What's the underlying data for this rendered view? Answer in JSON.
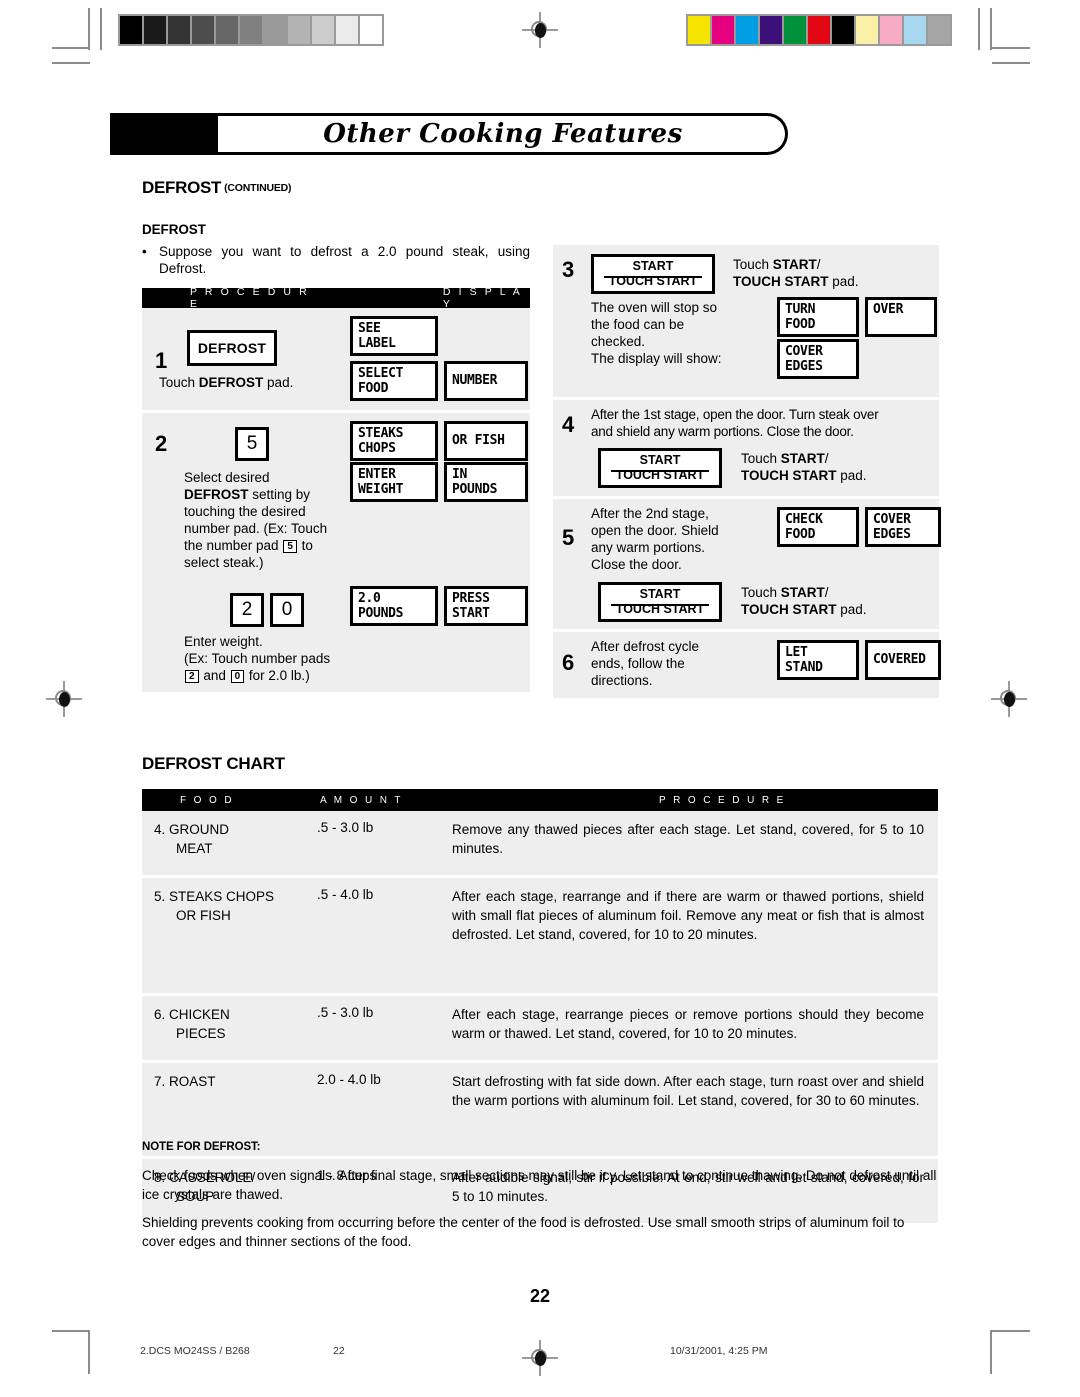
{
  "print_marks": {
    "grayscale_swatches": [
      "#000000",
      "#1a1a1a",
      "#333333",
      "#4d4d4d",
      "#666666",
      "#808080",
      "#999999",
      "#b3b3b3",
      "#cccccc",
      "#ebebeb",
      "#ffffff"
    ],
    "color_swatches": [
      "#f5e400",
      "#e4007f",
      "#009fe3",
      "#3b1079",
      "#00913a",
      "#e30613",
      "#000000",
      "#fbf0a8",
      "#f7abc4",
      "#a8d8f0",
      "#a6a6a6"
    ],
    "registration_icon": "registration-target-icon"
  },
  "header": {
    "chapter_title": "Other Cooking Features",
    "kicker": "DEFROST",
    "kicker_continued": "(CONTINUED)"
  },
  "intro": {
    "heading": "DEFROST",
    "bullet": "•",
    "text": "Suppose you want to defrost a 2.0 pound steak, using Defrost."
  },
  "procedure_table": {
    "col_procedure": "P R O C E D U R E",
    "col_display": "D I S P L A Y",
    "steps": [
      {
        "num": "1",
        "pad_label": "DEFROST",
        "caption_pre": "Touch ",
        "caption_bold": "DEFROST",
        "caption_post": " pad.",
        "displays": [
          {
            "lines": [
              "SEE",
              "LABEL"
            ]
          },
          {
            "lines": [
              "SELECT",
              "FOOD"
            ]
          },
          {
            "lines": [
              "NUMBER"
            ]
          }
        ]
      },
      {
        "num": "2",
        "numpad": "5",
        "caption_a_l1": "Select desired",
        "caption_a_bold": "DEFROST",
        "caption_a_l2": " setting by",
        "caption_a_l3": "touching the desired",
        "caption_a_l4a": "number pad. (Ex: Touch",
        "caption_a_l5a": "the number pad ",
        "caption_a_key": "5",
        "caption_a_l5b": " to",
        "caption_a_l6": "select steak.)",
        "numpad2": "2",
        "numpad3": "0",
        "caption_b_l1": "Enter weight.",
        "caption_b_l2": "(Ex: Touch number pads",
        "caption_b_key1": "2",
        "caption_b_mid": " and ",
        "caption_b_key2": "0",
        "caption_b_end": " for 2.0 lb.)",
        "displays": [
          {
            "lines": [
              "STEAKS",
              "CHOPS"
            ]
          },
          {
            "lines": [
              "OR FISH"
            ]
          },
          {
            "lines": [
              "ENTER",
              "WEIGHT"
            ]
          },
          {
            "lines": [
              "IN",
              "POUNDS"
            ]
          },
          {
            "lines": [
              "2.0",
              "POUNDS"
            ]
          },
          {
            "lines": [
              "PRESS",
              "START"
            ]
          }
        ]
      },
      {
        "num": "3",
        "start_pad_l1": "START",
        "start_pad_l2": "TOUCH START",
        "caption_pre": "Touch ",
        "caption_bold1": "START",
        "caption_slash": "/",
        "caption_bold2": "TOUCH START",
        "caption_post": " pad.",
        "body_l1": "The oven will stop so",
        "body_l2": "the food can be",
        "body_l3": "checked.",
        "body_l4": "The display will show:",
        "displays": [
          {
            "lines": [
              "TURN",
              "FOOD"
            ]
          },
          {
            "lines": [
              "OVER"
            ]
          },
          {
            "lines": [
              "COVER",
              "EDGES"
            ]
          }
        ]
      },
      {
        "num": "4",
        "body_l1": "After the 1st stage, open the door. Turn steak over",
        "body_l2": "and shield any warm portions. Close the door.",
        "start_pad_l1": "START",
        "start_pad_l2": "TOUCH START",
        "caption_pre": "Touch ",
        "caption_bold1": "START",
        "caption_slash": "/",
        "caption_bold2": "TOUCH START",
        "caption_post": " pad."
      },
      {
        "num": "5",
        "body_l1": "After the 2nd stage,",
        "body_l2": "open the door. Shield",
        "body_l3": "any warm portions.",
        "body_l4": "Close the door.",
        "start_pad_l1": "START",
        "start_pad_l2": "TOUCH START",
        "caption_pre": "Touch ",
        "caption_bold1": "START",
        "caption_slash": "/",
        "caption_bold2": "TOUCH START",
        "caption_post": " pad.",
        "displays": [
          {
            "lines": [
              "CHECK",
              "FOOD"
            ]
          },
          {
            "lines": [
              "COVER",
              "EDGES"
            ]
          }
        ]
      },
      {
        "num": "6",
        "body_l1": "After defrost cycle",
        "body_l2": "ends, follow the",
        "body_l3": "directions.",
        "displays": [
          {
            "lines": [
              "LET",
              "STAND"
            ]
          },
          {
            "lines": [
              "COVERED"
            ]
          }
        ]
      }
    ]
  },
  "defrost_chart": {
    "heading": "DEFROST CHART",
    "columns": [
      "F O O D",
      "A M O U N T",
      "P R O C E D U R E"
    ],
    "rows": [
      {
        "food": "4. GROUND\nMEAT",
        "amount": ".5  -  3.0 lb",
        "procedure": "Remove any thawed pieces after each stage. Let stand, covered, for 5 to 10 minutes."
      },
      {
        "food": "5. STEAKS CHOPS\nOR FISH",
        "amount": ".5  -  4.0 lb",
        "procedure": "After each stage, rearrange and if there are warm or thawed portions, shield with small flat pieces of aluminum foil. Remove any meat or fish that is almost defrosted. Let stand, covered, for 10 to 20 minutes."
      },
      {
        "food": "6. CHICKEN\nPIECES",
        "amount": ".5  -  3.0 lb",
        "procedure": "After each stage, rearrange pieces or remove portions should they become warm or thawed. Let stand, covered, for 10 to 20 minutes."
      },
      {
        "food": "7. ROAST",
        "amount": "2.0  -  4.0 lb",
        "procedure": "Start defrosting with fat side down. After each stage, turn roast over and shield the warm portions with aluminum foil. Let stand, covered, for 30 to 60 minutes."
      },
      {
        "food": "8. CASSEROLE/\nSOUP",
        "amount": "1  -  8 cups",
        "procedure": "After audible signal, stir if possible. At end, stir well and let stand, covered, for 5 to 10 minutes."
      }
    ]
  },
  "note": {
    "heading": "NOTE FOR DEFROST:",
    "paragraph1": "Check foods when oven signals. After final stage, small sections may still be icy. Let stand to continue thawing. Do not defrost until all ice crystals are thawed.",
    "paragraph2": "Shielding prevents cooking from occurring before the center of the food is defrosted. Use small smooth strips of aluminum foil to cover edges and thinner sections of the food."
  },
  "page_number": "22",
  "footer": {
    "left": "2.DCS MO24SS / B268",
    "middle": "22",
    "right": "10/31/2001, 4:25 PM"
  }
}
